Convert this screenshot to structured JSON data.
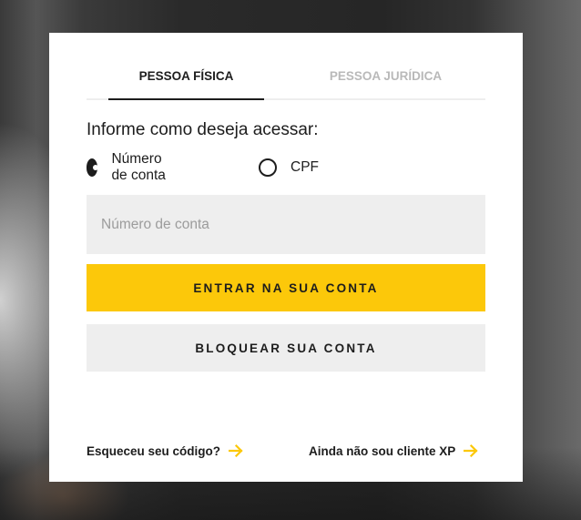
{
  "tabs": [
    {
      "label": "PESSOA FÍSICA",
      "active": true
    },
    {
      "label": "PESSOA JURÍDICA",
      "active": false
    }
  ],
  "form": {
    "prompt": "Informe como deseja acessar:",
    "options": [
      {
        "label": "Número de conta",
        "selected": true
      },
      {
        "label": "CPF",
        "selected": false
      }
    ],
    "input": {
      "placeholder": "Número de conta",
      "value": ""
    },
    "primary_button": "ENTRAR NA SUA CONTA",
    "secondary_button": "BLOQUEAR SUA CONTA"
  },
  "links": {
    "forgot": "Esqueceu seu código?",
    "not_client": "Ainda não sou cliente XP",
    "arrow_icon": "arrow-right-icon"
  },
  "colors": {
    "accent": "#fcc80a",
    "text": "#1d1d1d",
    "tab_inactive": "#b9b9b9",
    "field_bg": "#eeeeee"
  }
}
